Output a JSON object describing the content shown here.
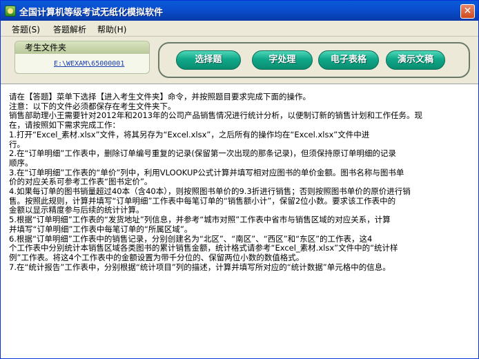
{
  "window": {
    "title": "全国计算机等级考试无纸化模拟软件",
    "close_glyph": "✕"
  },
  "menu": [
    {
      "label": "答题(S)"
    },
    {
      "label": "答题解析"
    },
    {
      "label": "帮助(H)"
    }
  ],
  "folder": {
    "label": "考生文件夹",
    "path": "E:\\WEXAM\\65000001"
  },
  "tabs": [
    {
      "label": "选择题"
    },
    {
      "label": "字处理"
    },
    {
      "label": "电子表格"
    },
    {
      "label": "演示文稿"
    }
  ],
  "content": {
    "lines": [
      "请在【答题】菜单下选择【进入考生文件夹】命令，并按照题目要求完成下面的操作。",
      "注意：以下的文件必须都保存在考生文件夹下。",
      "销售部助理小王需要针对2012年和2013年的公司产品销售情况进行统计分析，以便制订新的销售计划和工作任务。现",
      "在，请按照如下需求完成工作：",
      "1.打开“Excel_素材.xlsx”文件，将其另存为“Excel.xlsx”，之后所有的操作均在“Excel.xlsx”文件中进",
      "行。",
      "2.在“订单明细”工作表中，删除订单编号重复的记录(保留第一次出现的那条记录)，但须保持原订单明细的记录",
      "顺序。",
      "3.在“订单明细”工作表的“单价”列中，利用VLOOKUP公式计算并填写相对应图书的单价金额。图书名称与图书单",
      "价的对应关系可参考工作表“图书定价”。",
      "4.如果每订单的图书销量超过40本（含40本），则按照图书单价的9.3折进行销售；否则按照图书单价的原价进行销",
      "售。按照此规则，计算并填写“订单明细”工作表中每笔订单的“销售额小计”，保留2位小数。要求该工作表中的",
      "金额以显示精度参与后续的统计计算。",
      "5.根据“订单明细”工作表的“发货地址”列信息，并参考“城市对照”工作表中省市与销售区域的对应关系，计算",
      "并填写“订单明细”工作表中每笔订单的“所属区域”。",
      "6.根据“订单明细”工作表中的销售记录，分别创建名为“北区”、“南区”、“西区”和“东区”的工作表，这4",
      "个工作表中分别统计本销售区域各类图书的累计销售金额，统计格式请参考“Excel_素材.xlsx”文件中的“统计样",
      "例”工作表。将这4个工作表中的金额设置为带千分位的、保留两位小数的数值格式。",
      "7.在“统计报告”工作表中，分别根据“统计项目”列的描述，计算并填写所对应的“统计数据”单元格中的信息。"
    ]
  }
}
